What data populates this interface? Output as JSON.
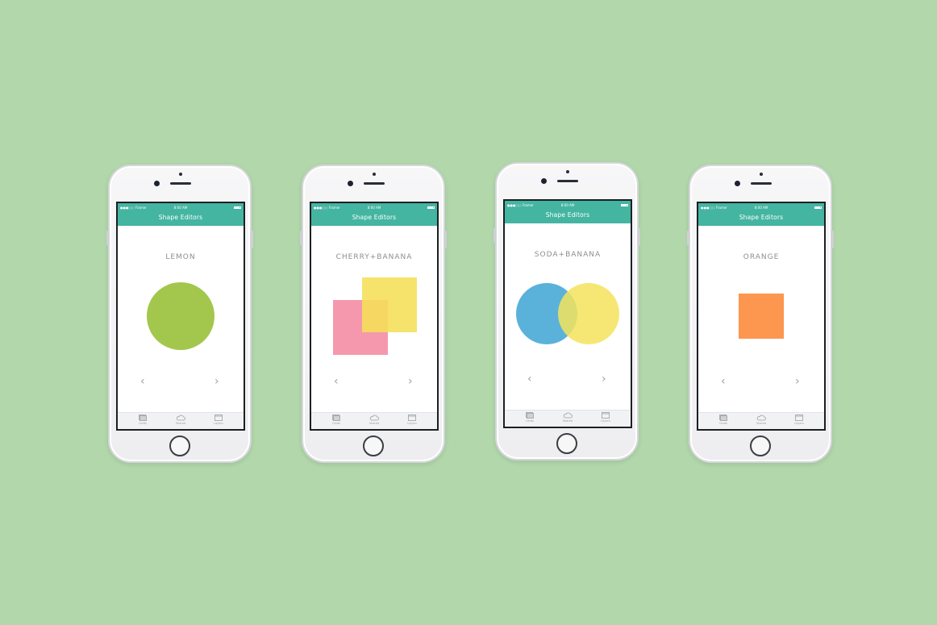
{
  "background_color": "#b1d7ab",
  "status": {
    "carrier": "●●●○○ Framer",
    "wifi_icon": "wifi-icon",
    "time": "8:00 AM"
  },
  "nav": {
    "title": "Shape Editors",
    "color": "#44b5a1"
  },
  "arrows": {
    "prev": "‹",
    "next": "›"
  },
  "tabs": [
    {
      "label": "Cards",
      "icon": "cards-icon"
    },
    {
      "label": "Shared",
      "icon": "cloud-icon"
    },
    {
      "label": "Layers",
      "icon": "layers-icon"
    }
  ],
  "phones": [
    {
      "label": "LEMON",
      "shapes": [
        {
          "kind": "circle",
          "color": "#a3c74c"
        }
      ]
    },
    {
      "label": "CHERRY+BANANA",
      "shapes": [
        {
          "kind": "square",
          "color": "#f598ad"
        },
        {
          "kind": "square",
          "color": "#f5df58"
        }
      ]
    },
    {
      "label": "SODA+BANANA",
      "shapes": [
        {
          "kind": "circle",
          "color": "#5ab2da"
        },
        {
          "kind": "circle",
          "color": "#f5e35c"
        }
      ]
    },
    {
      "label": "ORANGE",
      "shapes": [
        {
          "kind": "square",
          "color": "#fd964f"
        }
      ]
    }
  ]
}
